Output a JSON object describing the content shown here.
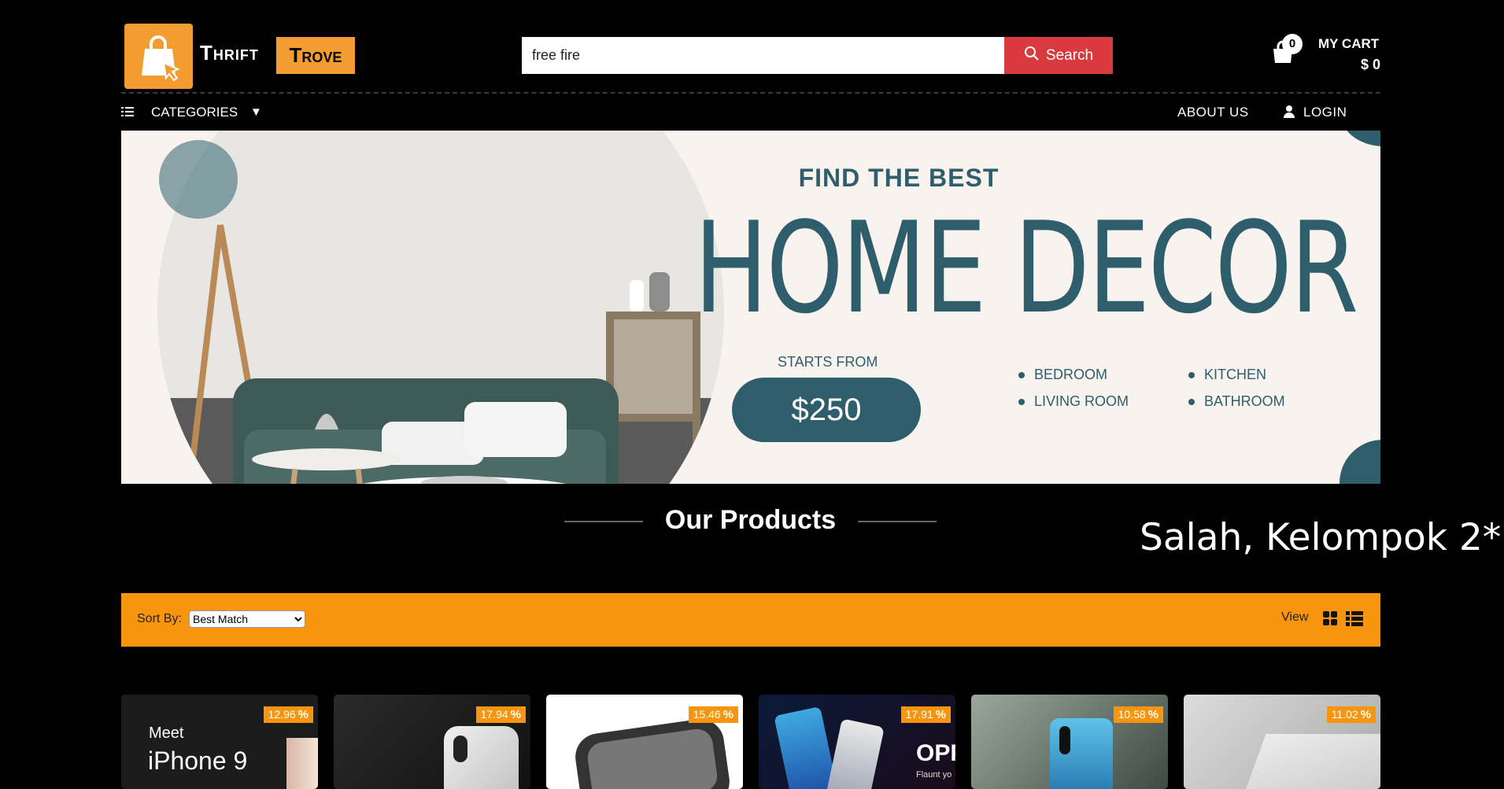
{
  "header": {
    "logo_word1": "Thrift",
    "logo_word2": "Trove",
    "search": {
      "value": "free fire",
      "button_label": "Search"
    },
    "cart": {
      "count": "0",
      "label": "MY CART",
      "total": "$ 0"
    }
  },
  "nav": {
    "categories_label": "CATEGORIES",
    "about_label": "ABOUT US",
    "login_label": "LOGIN"
  },
  "banner": {
    "headline_small": "FIND THE BEST",
    "headline_large": "HOME DECOR",
    "starts_from": "STARTS FROM",
    "price": "$250",
    "rooms": [
      "BEDROOM",
      "KITCHEN",
      "LIVING ROOM",
      "BATHROOM"
    ]
  },
  "products": {
    "title": "Our Products",
    "overlay_text": "Salah, Kelompok 2*"
  },
  "sort_bar": {
    "sort_label": "Sort By:",
    "sort_selected": "Best Match",
    "view_label": "View"
  },
  "cards": [
    {
      "discount": "12.96",
      "caption_line1": "Meet",
      "caption_line2": "iPhone 9"
    },
    {
      "discount": "17.94"
    },
    {
      "discount": "15.46"
    },
    {
      "discount": "17.91",
      "caption_line1": "OPP",
      "caption_line2": "Flaunt yo"
    },
    {
      "discount": "10.58"
    },
    {
      "discount": "11.02"
    }
  ],
  "colors": {
    "brand_orange": "#f39c2f",
    "search_red": "#d93a3e",
    "banner_teal": "#2e5e6b",
    "sort_bar_orange": "#f7950f"
  }
}
